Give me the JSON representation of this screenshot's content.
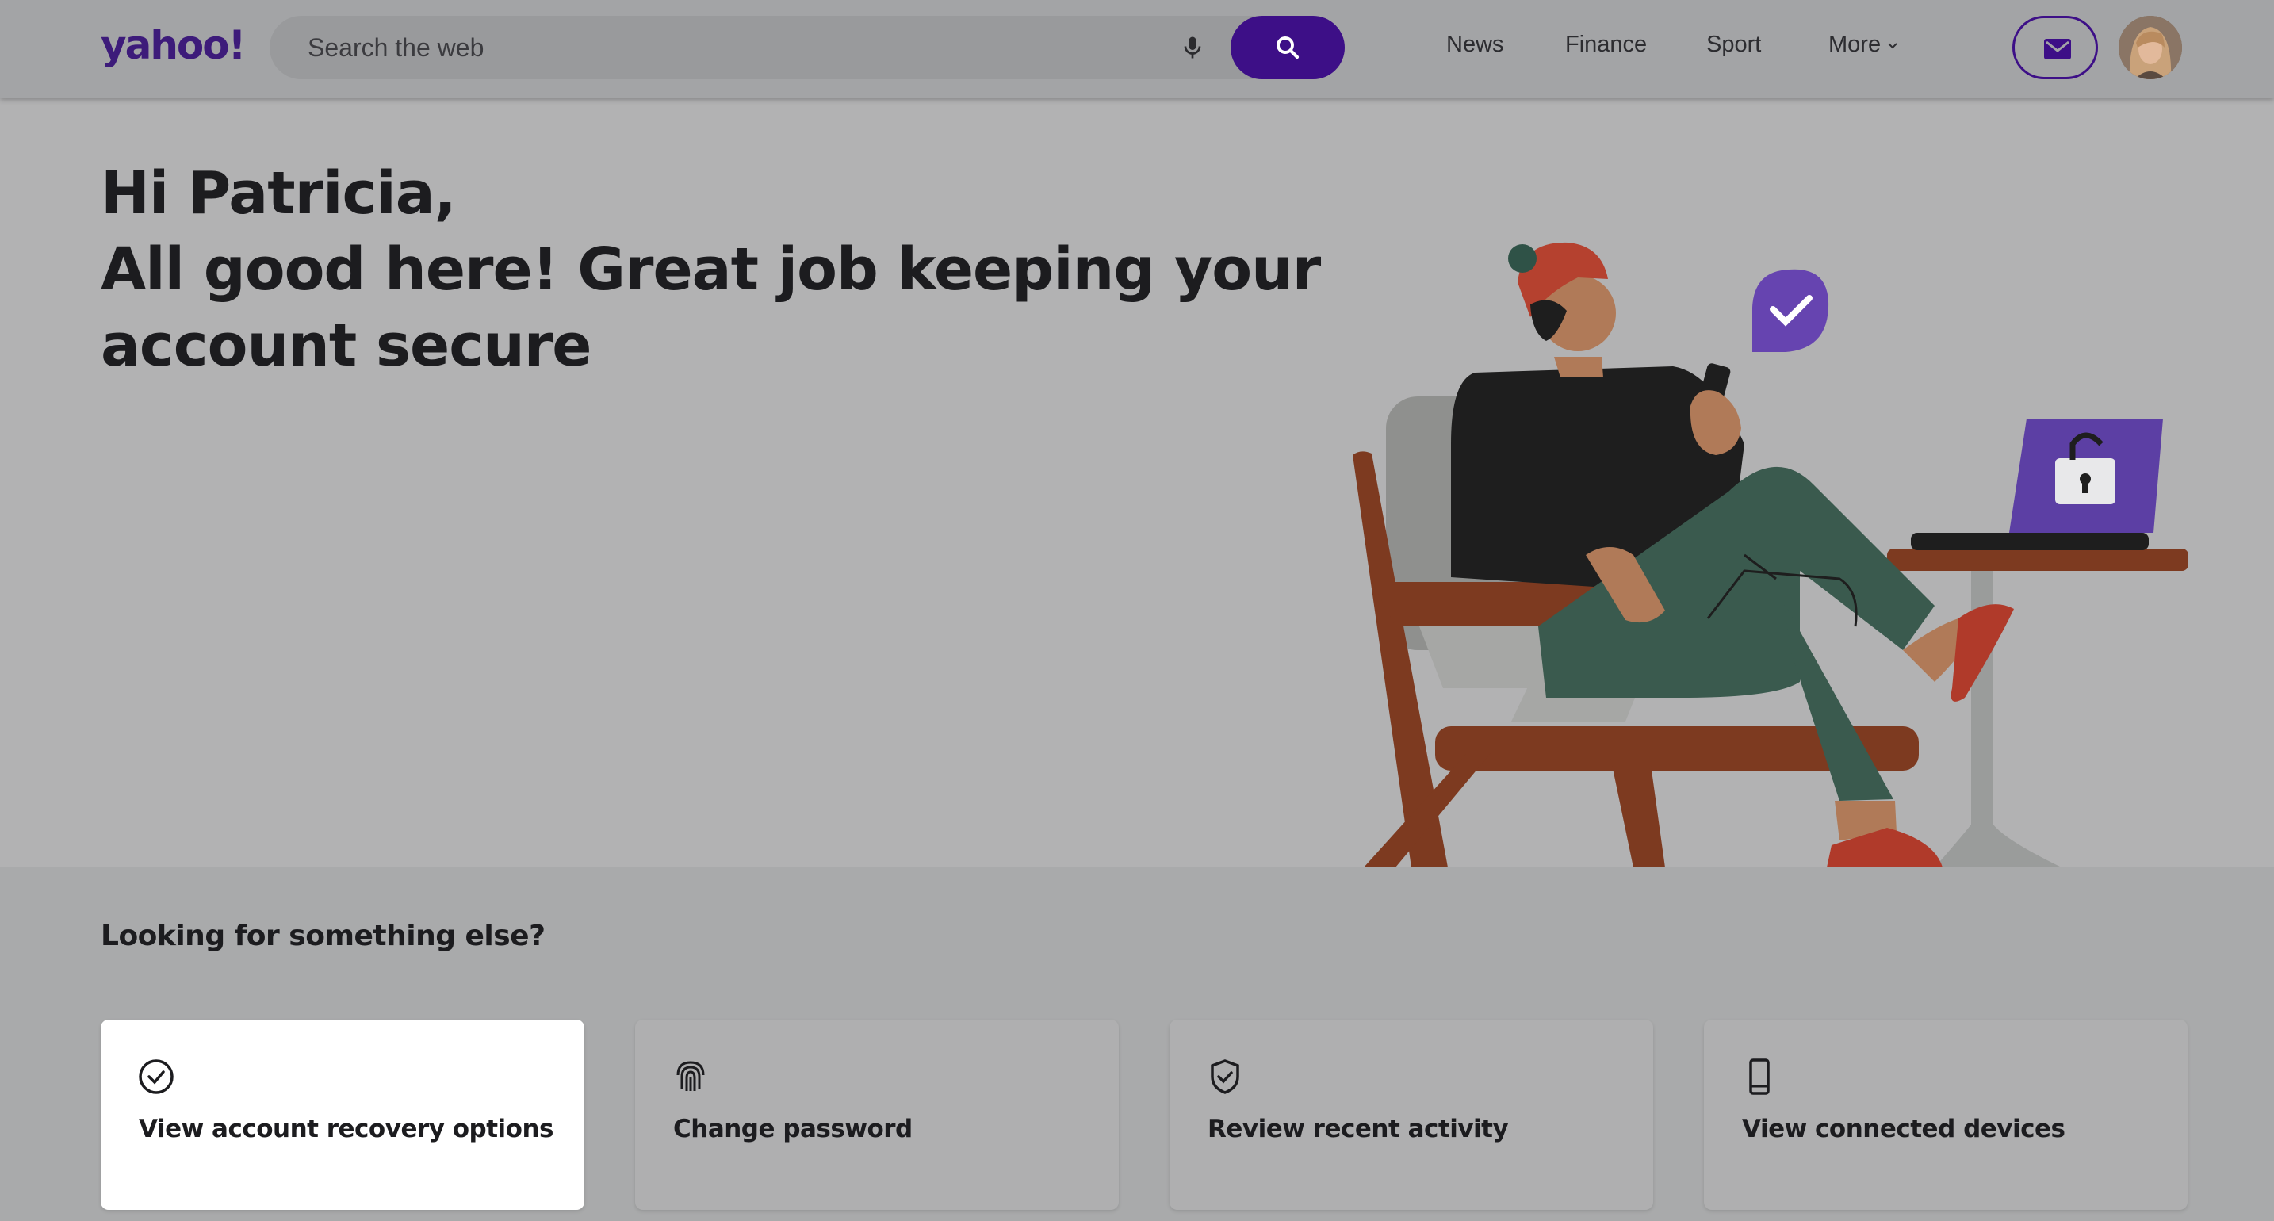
{
  "header": {
    "logo": "yahoo!",
    "search": {
      "placeholder": "Search the web",
      "value": ""
    },
    "nav": [
      {
        "label": "News"
      },
      {
        "label": "Finance"
      },
      {
        "label": "Sport"
      },
      {
        "label": "More"
      }
    ]
  },
  "hero": {
    "greeting_line1": "Hi Patricia,",
    "greeting_line2": "All good here! Great job keeping your",
    "greeting_line3": "account secure"
  },
  "options": {
    "title": "Looking for something else?",
    "cards": [
      {
        "label": "View account recovery options",
        "icon": "check-circle-icon"
      },
      {
        "label": "Change password",
        "icon": "fingerprint-icon"
      },
      {
        "label": "Review recent activity",
        "icon": "shield-check-icon"
      },
      {
        "label": "View connected devices",
        "icon": "phone-icon"
      }
    ]
  },
  "colors": {
    "brand": "#3d0f87",
    "overlay_bg": "#a9aaab",
    "card_active": "#ffffff"
  }
}
